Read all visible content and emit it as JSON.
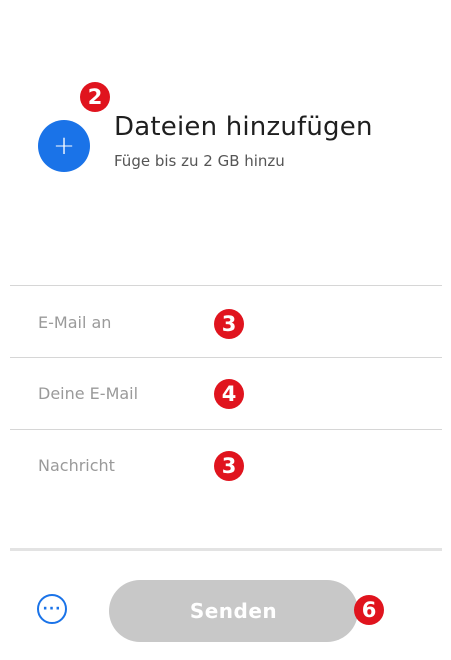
{
  "upload": {
    "icon": "plus-icon",
    "title": "Dateien hinzufügen",
    "subtitle": "Füge bis zu 2 GB hinzu",
    "accent_color": "#1a73e8"
  },
  "form": {
    "email_to_placeholder": "E-Mail an",
    "your_email_placeholder": "Deine E-Mail",
    "message_placeholder": "Nachricht"
  },
  "footer": {
    "more_icon": "more-options-icon",
    "send_label": "Senden"
  },
  "annotations": {
    "upload_badge": "2",
    "email_to_badge": "3",
    "your_email_badge": "4",
    "message_badge": "3",
    "send_badge": "6",
    "badge_color": "#e0141e"
  }
}
